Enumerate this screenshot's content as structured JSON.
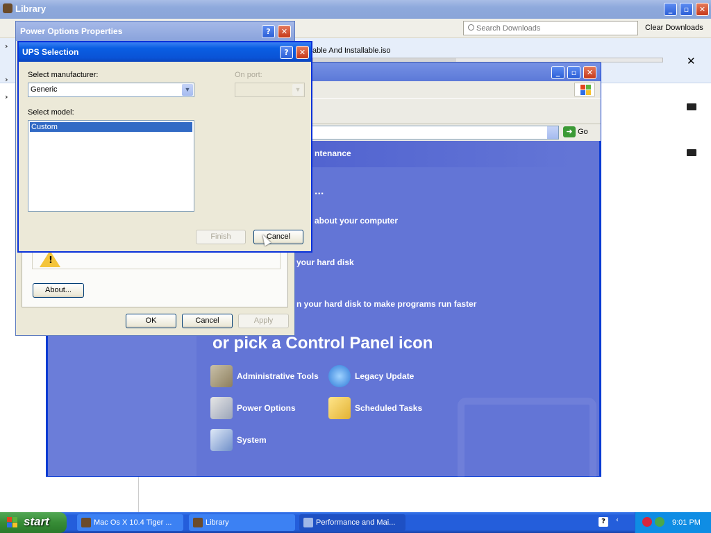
{
  "library": {
    "title": "Library",
    "search_placeholder": "Search Downloads",
    "clear_downloads": "Clear Downloads",
    "download_name": "able And Installable.iso",
    "download_progress": 0.41,
    "close_glyph": "✕",
    "tree_glyph": "›"
  },
  "control_panel": {
    "go_label": "Go",
    "task_band": "ntenance",
    "dots": "...",
    "task1": "about your computer",
    "task2": "your hard disk",
    "task3": "n your hard disk to make programs run faster",
    "heading": "or pick a Control Panel icon",
    "icons": [
      {
        "label": "Administrative Tools",
        "icon": "admin-tools-icon"
      },
      {
        "label": "Legacy Update",
        "icon": "legacy-update-icon"
      },
      {
        "label": "Power Options",
        "icon": "power-options-icon"
      },
      {
        "label": "Scheduled Tasks",
        "icon": "scheduled-tasks-icon"
      },
      {
        "label": "System",
        "icon": "system-icon"
      }
    ]
  },
  "power_options": {
    "title": "Power Options Properties",
    "about_label": "About...",
    "ok_label": "OK",
    "cancel_label": "Cancel",
    "apply_label": "Apply",
    "help_glyph": "?",
    "close_glyph": "✕"
  },
  "ups_selection": {
    "title": "UPS Selection",
    "manufacturer_label": "Select manufacturer:",
    "manufacturer_value": "Generic",
    "port_label": "On port:",
    "port_value": "",
    "model_label": "Select model:",
    "models": [
      "Custom"
    ],
    "finish_label": "Finish",
    "cancel_label": "Cancel",
    "help_glyph": "?",
    "close_glyph": "✕"
  },
  "taskbar": {
    "start_label": "start",
    "tasks": [
      {
        "label": "Mac Os X 10.4 Tiger ..."
      },
      {
        "label": "Library"
      },
      {
        "label": "Performance and Mai..."
      }
    ],
    "clock": "9:01 PM"
  },
  "colors": {
    "xp_title_blue": "#0a53d6",
    "cp_background": "#6375d6",
    "taskbar_blue": "#245edb",
    "start_green": "#378c36"
  }
}
